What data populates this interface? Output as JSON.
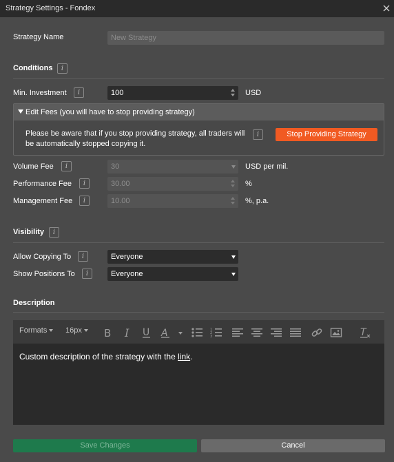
{
  "window": {
    "title": "Strategy Settings - Fondex"
  },
  "strategy_name": {
    "label": "Strategy Name",
    "placeholder": "New Strategy"
  },
  "conditions": {
    "title": "Conditions",
    "min_investment": {
      "label": "Min. Investment",
      "value": "100",
      "unit": "USD"
    },
    "edit_fees": {
      "header": "Edit Fees (you will have to stop providing strategy)",
      "note": "Please be aware that if you stop providing strategy, all traders will be automatically stopped copying it.",
      "stop_button": "Stop Providing Strategy"
    },
    "volume_fee": {
      "label": "Volume Fee",
      "value": "30",
      "unit": "USD per mil."
    },
    "performance_fee": {
      "label": "Performance Fee",
      "value": "30.00",
      "unit": "%"
    },
    "management_fee": {
      "label": "Management Fee",
      "value": "10.00",
      "unit": "%, p.a."
    }
  },
  "visibility": {
    "title": "Visibility",
    "allow_copying": {
      "label": "Allow Copying To",
      "value": "Everyone"
    },
    "show_positions": {
      "label": "Show Positions To",
      "value": "Everyone"
    }
  },
  "description": {
    "title": "Description",
    "toolbar": {
      "formats": "Formats",
      "font_size": "16px"
    },
    "content_text": "Custom description of the strategy with the ",
    "content_link": "link",
    "content_end": "."
  },
  "footer": {
    "save": "Save Changes",
    "cancel": "Cancel"
  },
  "colors": {
    "accent_orange": "#f15a22",
    "save_green": "#1e7a4c",
    "background": "#4a4a4a"
  }
}
